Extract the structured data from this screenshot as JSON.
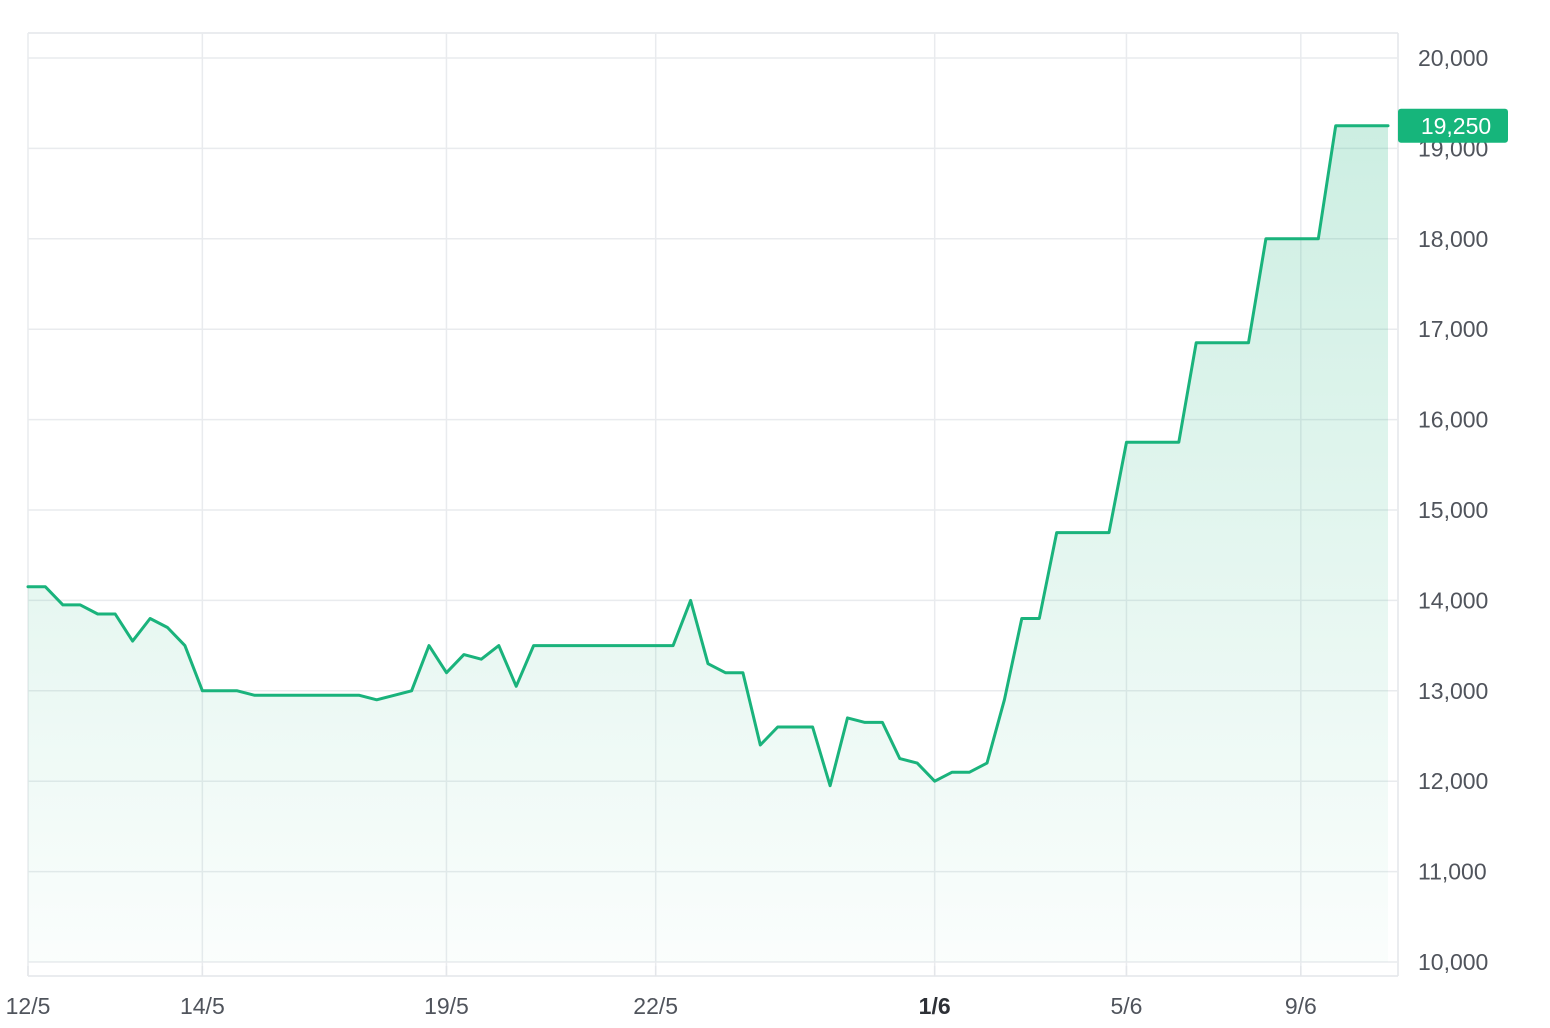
{
  "chart_data": {
    "type": "area",
    "x_tick_labels": [
      "12/5",
      "14/5",
      "19/5",
      "22/5",
      "1/6",
      "5/6",
      "9/6"
    ],
    "x_tick_bold": "1/6",
    "y_tick_labels": [
      "10,000",
      "11,000",
      "12,000",
      "13,000",
      "14,000",
      "15,000",
      "16,000",
      "17,000",
      "18,000",
      "19,000",
      "20,000"
    ],
    "ylim": [
      10000,
      20000
    ],
    "y_axis_side": "right",
    "grid": true,
    "last_value_label": "19,250",
    "colors": {
      "line": "#1ab37c",
      "fill": "#1ab37c",
      "badge": "#16b57b"
    },
    "series": [
      {
        "values": [
          14150,
          14150,
          13950,
          13950,
          13850,
          13850,
          13550,
          13800,
          13700,
          13500,
          13000,
          13000,
          13000,
          12950,
          12950,
          12950,
          12950,
          12950,
          12950,
          12950,
          12900,
          12950,
          13000,
          13500,
          13200,
          13400,
          13350,
          13500,
          13050,
          13500,
          13500,
          13500,
          13500,
          13500,
          13500,
          13500,
          13500,
          13500,
          14000,
          13300,
          13200,
          13200,
          12400,
          12600,
          12600,
          12600,
          11950,
          12700,
          12650,
          12650,
          12250,
          12200,
          12000,
          12100,
          12100,
          12200,
          12900,
          13800,
          13800,
          14750,
          14750,
          14750,
          14750,
          15750,
          15750,
          15750,
          15750,
          16850,
          16850,
          16850,
          16850,
          18000,
          18000,
          18000,
          18000,
          19250,
          19250,
          19250,
          19250
        ]
      }
    ]
  }
}
